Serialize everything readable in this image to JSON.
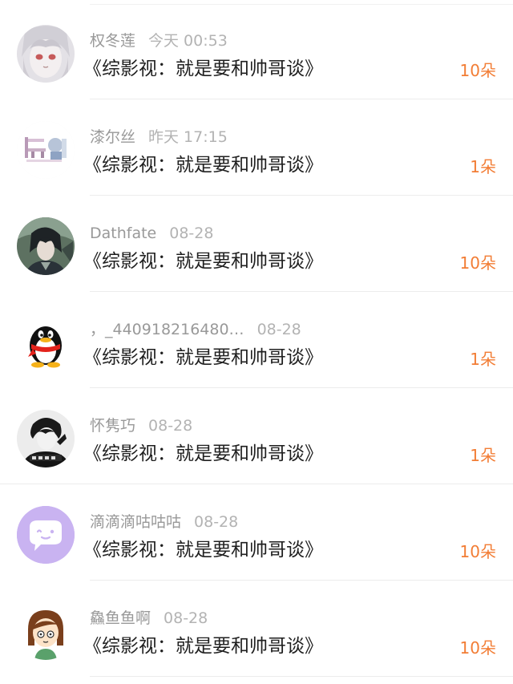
{
  "list": {
    "items": [
      {
        "username": "权冬莲",
        "time": "今天 00:53",
        "title": "《综影视：就是要和帅哥谈》",
        "amount": "10朵",
        "avatar_icon": "anime-girl-avatar-icon"
      },
      {
        "username": "漆尔丝",
        "time": "昨天 17:15",
        "title": "《综影视：就是要和帅哥谈》",
        "amount": "1朵",
        "avatar_icon": "pixel-art-avatar-icon"
      },
      {
        "username": "Dathfate",
        "time": "08-28",
        "title": "《综影视：就是要和帅哥谈》",
        "amount": "10朵",
        "avatar_icon": "dark-hero-avatar-icon"
      },
      {
        "username": "，_440918216480…",
        "time": "08-28",
        "title": "《综影视：就是要和帅哥谈》",
        "amount": "1朵",
        "avatar_icon": "qq-penguin-avatar-icon"
      },
      {
        "username": "怀隽巧",
        "time": "08-28",
        "title": "《综影视：就是要和帅哥谈》",
        "amount": "1朵",
        "avatar_icon": "bw-boy-avatar-icon"
      },
      {
        "username": "滴滴滴咕咕咕",
        "time": "08-28",
        "title": "《综影视：就是要和帅哥谈》",
        "amount": "10朵",
        "avatar_icon": "chat-bubble-avatar-icon"
      },
      {
        "username": "鱻鱼鱼啊",
        "time": "08-28",
        "title": "《综影视：就是要和帅哥谈》",
        "amount": "10朵",
        "avatar_icon": "cartoon-girl-avatar-icon"
      }
    ]
  }
}
